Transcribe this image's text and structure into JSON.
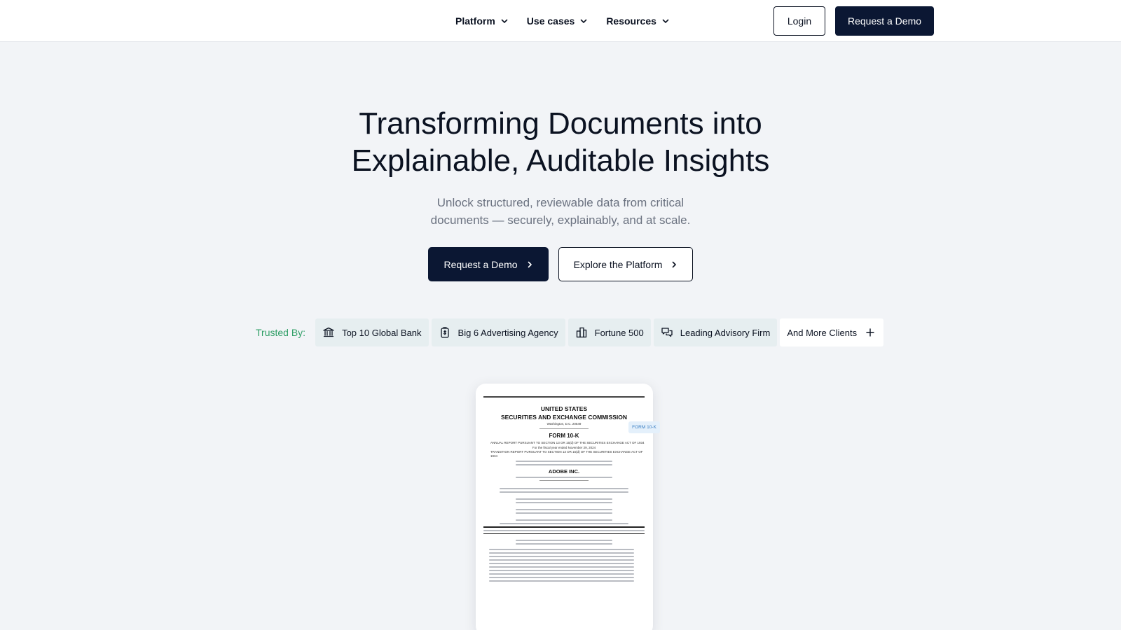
{
  "nav": {
    "items": [
      {
        "label": "Platform"
      },
      {
        "label": "Use cases"
      },
      {
        "label": "Resources"
      }
    ],
    "login_label": "Login",
    "demo_label": "Request a Demo"
  },
  "hero": {
    "title_line1": "Transforming Documents into",
    "title_line2": "Explainable, Auditable Insights",
    "subtitle": "Unlock structured, reviewable data from critical documents — securely, explainably, and at scale.",
    "primary_cta": "Request a Demo",
    "secondary_cta": "Explore the Platform"
  },
  "trusted": {
    "label": "Trusted By:",
    "chips": [
      {
        "label": "Top 10 Global Bank",
        "icon": "bank-icon"
      },
      {
        "label": "Big 6 Advertising Agency",
        "icon": "money-bag-icon"
      },
      {
        "label": "Fortune 500",
        "icon": "buildings-icon"
      },
      {
        "label": "Leading Advisory Firm",
        "icon": "chat-bubbles-icon"
      },
      {
        "label": "And More Clients",
        "icon": "plus-icon"
      }
    ]
  },
  "document_preview": {
    "header_line1": "UNITED STATES",
    "header_line2": "SECURITIES AND EXCHANGE COMMISSION",
    "header_city": "Washington, D.C. 20549",
    "form_title": "FORM 10-K",
    "annual_report": "ANNUAL REPORT PURSUANT TO SECTION 13 OR 15(d) OF THE SECURITIES EXCHANGE ACT OF 1934",
    "fiscal_year": "For the fiscal year ended November 29, 2024",
    "transition_report": "TRANSITION REPORT PURSUANT TO SECTION 13 OR 15(d) OF THE SECURITIES EXCHANGE ACT OF 1934",
    "company": "ADOBE INC.",
    "badge": "FORM 10-K"
  },
  "colors": {
    "primary": "#0b1733",
    "trusted_label": "#2f9e66",
    "chip_bg": "#e6eef0",
    "badge_text": "#3a7fc4"
  }
}
